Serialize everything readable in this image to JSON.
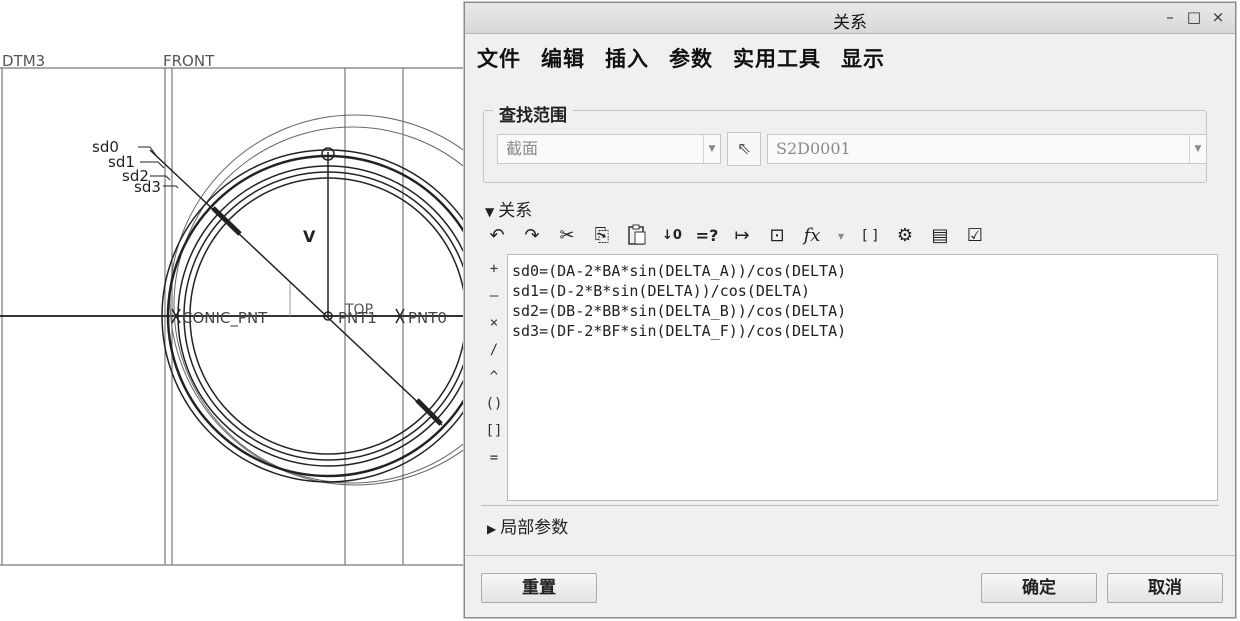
{
  "cad_view": {
    "datum_labels": [
      "DTM3",
      "FRONT",
      "TOP"
    ],
    "point_labels": [
      "CONIC_PNT",
      "PNT1",
      "PNT0"
    ],
    "dimension_labels": [
      "sd0",
      "sd1",
      "sd2",
      "sd3"
    ],
    "vector_label": "V"
  },
  "dialog": {
    "title": "关系",
    "window_buttons": {
      "minimize": "–",
      "maximize": "□",
      "close": "×"
    },
    "menu": [
      "文件",
      "编辑",
      "插入",
      "参数",
      "实用工具",
      "显示"
    ],
    "lookup": {
      "title": "查找范围",
      "scope_value": "截面",
      "item_value": "S2D0001"
    },
    "relations_section": {
      "label": "关系",
      "expanded": true
    },
    "toolbar_icons": [
      "undo-icon",
      "redo-icon",
      "cut-icon",
      "copy-icon",
      "paste-icon",
      "sort-relations-icon",
      "evaluate-icon",
      "dimension-icon",
      "verify-icon",
      "function-icon",
      "brackets-icon",
      "local-params-icon",
      "display-icon",
      "check-icon"
    ],
    "toolbar_glyphs": {
      "undo": "↶",
      "redo": "↷",
      "cut": "✂",
      "copy": "⎘",
      "paste": "📋",
      "sort": "↓0",
      "evaluate": "=?",
      "dimension": "↦",
      "verify": "⊡",
      "function": "fx",
      "dropdown": "▾",
      "brackets": "[ ]",
      "local_params": "⚙",
      "display": "▤",
      "check": "☑"
    },
    "operators": [
      "+",
      "–",
      "×",
      "/",
      "^",
      "()",
      "[]",
      "="
    ],
    "relations": [
      "sd0=(DA-2*BA*sin(DELTA_A))/cos(DELTA)",
      "sd1=(D-2*B*sin(DELTA))/cos(DELTA)",
      "sd2=(DB-2*BB*sin(DELTA_B))/cos(DELTA)",
      "sd3=(DF-2*BF*sin(DELTA_F))/cos(DELTA)"
    ],
    "local_params_section": {
      "label": "局部参数",
      "expanded": false
    },
    "buttons": {
      "reset": "重置",
      "ok": "确定",
      "cancel": "取消"
    }
  }
}
